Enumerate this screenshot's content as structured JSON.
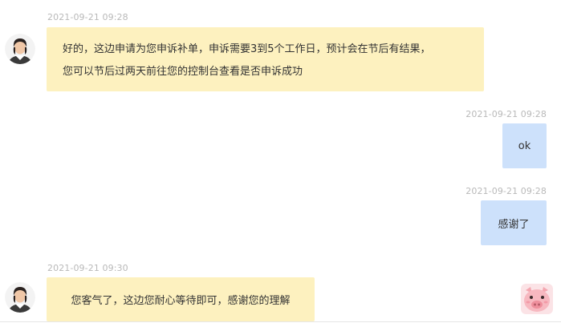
{
  "messages": [
    {
      "sender": "agent",
      "timestamp": "2021-09-21 09:28",
      "lines": [
        "好的，这边申请为您申诉补单，申诉需要3到5个工作日，预计会在节后有结果，",
        "您可以节后过两天前往您的控制台查看是否申诉成功"
      ]
    },
    {
      "sender": "user",
      "timestamp": "2021-09-21 09:28",
      "text": "ok"
    },
    {
      "sender": "user",
      "timestamp": "2021-09-21 09:28",
      "text": "感谢了"
    },
    {
      "sender": "agent",
      "timestamp": "2021-09-21 09:30",
      "text": "您客气了，这边您耐心等待即可，感谢您的理解"
    }
  ],
  "avatars": {
    "agent": "agent-avatar",
    "user": "pig-avatar"
  },
  "colors": {
    "agent_bubble": "#fdf1bf",
    "user_bubble": "#cde1fb",
    "timestamp": "#b9b9b9",
    "text": "#333333"
  }
}
